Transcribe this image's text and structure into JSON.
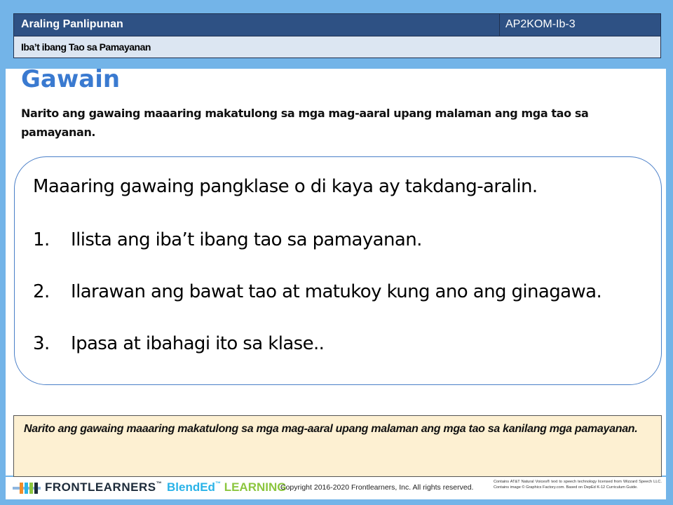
{
  "header": {
    "subject": "Araling Panlipunan",
    "code": "AP2KOM-Ib-3",
    "topic": "Iba’t ibang Tao sa Pamayanan"
  },
  "main": {
    "title": "Gawain",
    "intro": "Narito ang gawaing maaaring makatulong sa mga mag-aaral upang malaman ang mga tao sa pamayanan.",
    "task_heading": "Maaaring gawaing pangklase o di kaya ay takdang-aralin.",
    "tasks": [
      {
        "num": "1.",
        "text": "Ilista ang iba’t ibang tao sa pamayanan."
      },
      {
        "num": "2.",
        "text": "Ilarawan ang bawat tao at matukoy kung ano ang ginagawa."
      },
      {
        "num": "3.",
        "text": "Ipasa at ibahagi ito sa klase.."
      }
    ]
  },
  "note": {
    "text": "Narito ang gawaing maaaring makatulong sa mga mag-aaral upang malaman ang mga tao sa kanilang mga pamayanan."
  },
  "footer": {
    "brand": "FRONTLEARNERS",
    "brand_tm": "™",
    "blended_prefix": "BlendEd",
    "blended_sup": "™",
    "blended_suffix": "LEARNING",
    "copyright": "Copyright 2016-2020 Frontlearners, Inc.  All rights reserved.",
    "fine_print": "Contains AT&T Natural Voices® text to speech technology licensed from Wizzard Speech LLC. Contains image © Graphics Factory.com. Based on DepEd K-12 Curriculum Guide."
  },
  "colors": {
    "background": "#73b4e8",
    "header_bar": "#2e5184",
    "title": "#3a7ad0",
    "note_bg": "#fdf0d2",
    "blended": "#2ab3e8",
    "learning": "#8cc63f"
  }
}
